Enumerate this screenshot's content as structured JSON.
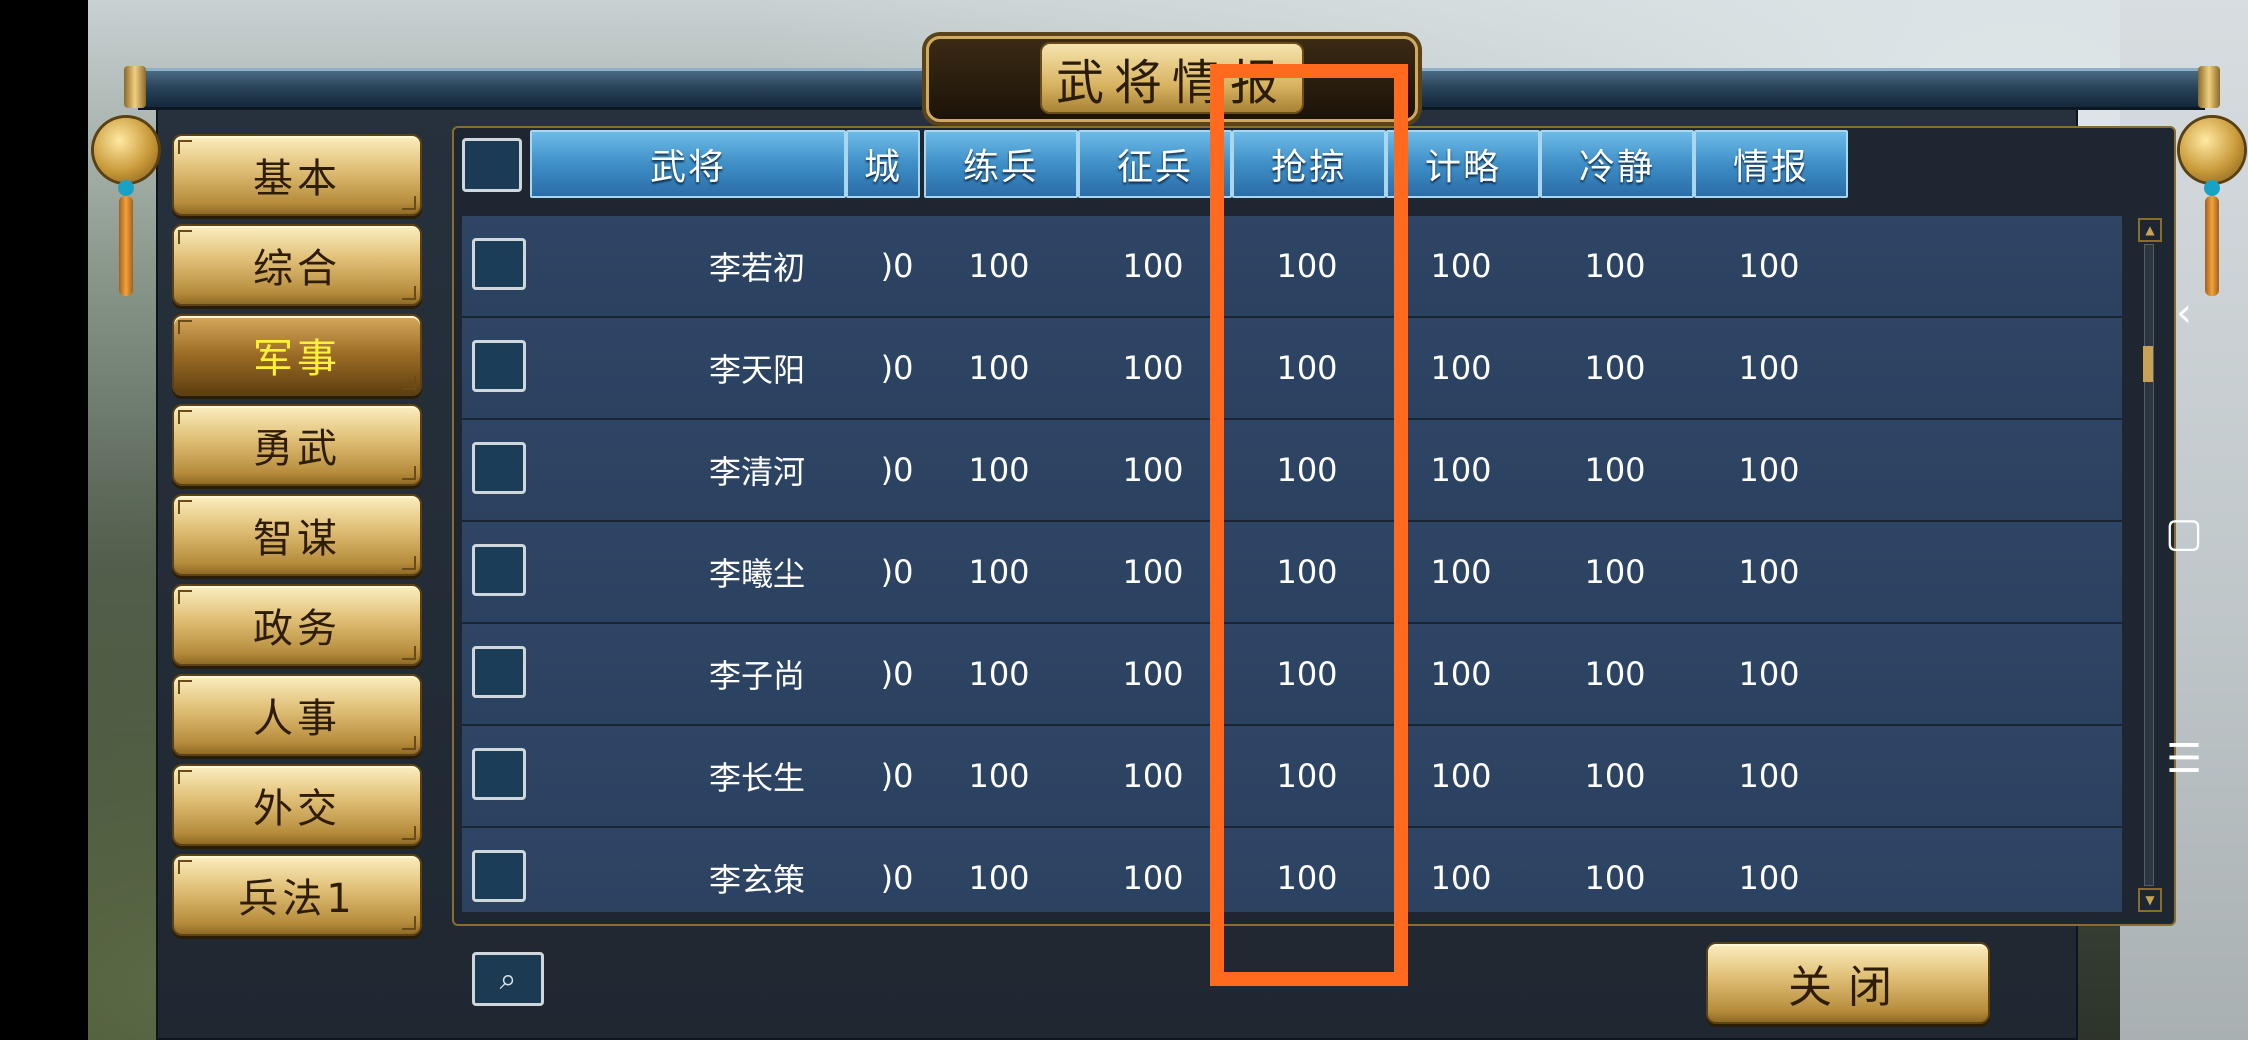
{
  "title": "武将情报",
  "menu": [
    {
      "label": "基本",
      "active": false
    },
    {
      "label": "综合",
      "active": false
    },
    {
      "label": "军事",
      "active": true
    },
    {
      "label": "勇武",
      "active": false
    },
    {
      "label": "智谋",
      "active": false
    },
    {
      "label": "政务",
      "active": false
    },
    {
      "label": "人事",
      "active": false
    },
    {
      "label": "外交",
      "active": false
    },
    {
      "label": "兵法1",
      "active": false
    }
  ],
  "table": {
    "headers": [
      "武将",
      "城",
      "练兵",
      "征兵",
      "抢掠",
      "计略",
      "冷静",
      "情报"
    ],
    "rows": [
      {
        "name": "李若初",
        "cols": [
          ")0",
          "100",
          "100",
          "100",
          "100",
          "100",
          "100"
        ]
      },
      {
        "name": "李天阳",
        "cols": [
          ")0",
          "100",
          "100",
          "100",
          "100",
          "100",
          "100"
        ]
      },
      {
        "name": "李清河",
        "cols": [
          ")0",
          "100",
          "100",
          "100",
          "100",
          "100",
          "100"
        ]
      },
      {
        "name": "李曦尘",
        "cols": [
          ")0",
          "100",
          "100",
          "100",
          "100",
          "100",
          "100"
        ]
      },
      {
        "name": "李子尚",
        "cols": [
          ")0",
          "100",
          "100",
          "100",
          "100",
          "100",
          "100"
        ]
      },
      {
        "name": "李长生",
        "cols": [
          ")0",
          "100",
          "100",
          "100",
          "100",
          "100",
          "100"
        ]
      },
      {
        "name": "李玄策",
        "cols": [
          ")0",
          "100",
          "100",
          "100",
          "100",
          "100",
          "100"
        ]
      }
    ]
  },
  "buttons": {
    "close": "关闭"
  },
  "system_nav": {
    "back": "‹",
    "home": "▢",
    "menu": "☰"
  },
  "colors": {
    "highlight": "#ff6a1f",
    "active_menu_text": "#fff13a"
  }
}
